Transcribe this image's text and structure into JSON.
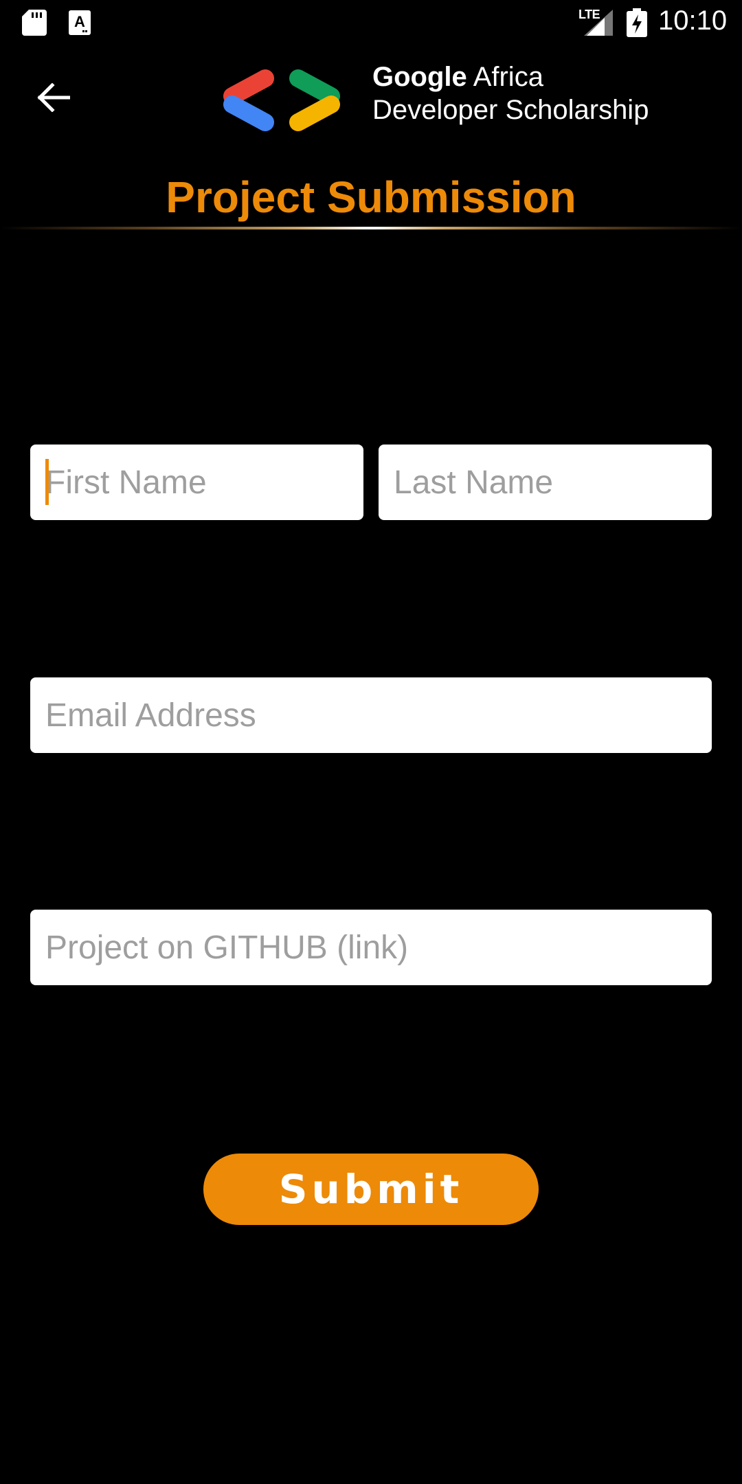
{
  "status_bar": {
    "time": "10:10",
    "network_label": "LTE",
    "icons": [
      "sd-card-icon",
      "keyboard-a-icon",
      "signal-icon",
      "battery-charging-icon"
    ]
  },
  "toolbar": {
    "back_icon": "arrow-left-icon",
    "logo": {
      "line1_brand": "Google",
      "line1_rest": " Africa",
      "line2": "Developer Scholarship",
      "colors": {
        "red": "#EA4335",
        "blue": "#4285F4",
        "green": "#0F9D58",
        "yellow": "#F4B400"
      }
    }
  },
  "page": {
    "title": "Project Submission"
  },
  "form": {
    "first_name": {
      "value": "",
      "placeholder": "First Name"
    },
    "last_name": {
      "value": "",
      "placeholder": "Last Name"
    },
    "email": {
      "value": "",
      "placeholder": "Email Address"
    },
    "github": {
      "value": "",
      "placeholder": "Project on GITHUB (link)"
    },
    "submit_label": "Submit"
  },
  "colors": {
    "accent": "#ED8A08",
    "background": "#000000",
    "field_background": "#FFFFFF",
    "placeholder": "#9E9E9E"
  }
}
